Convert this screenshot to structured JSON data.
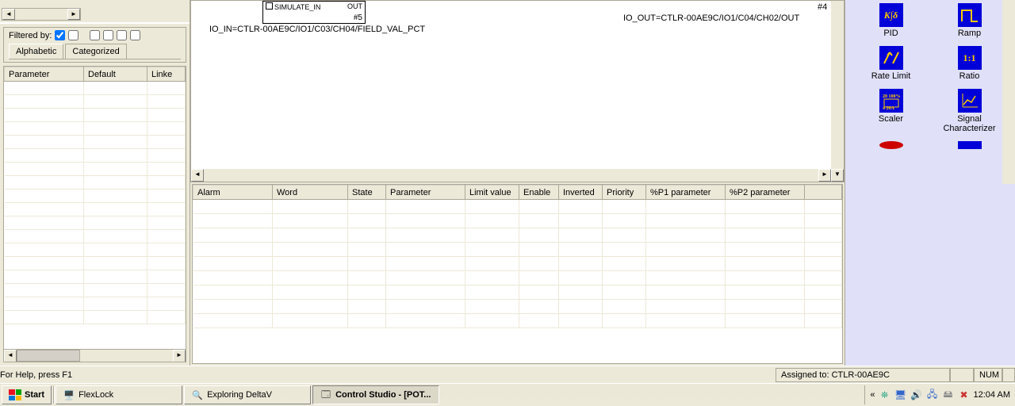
{
  "left": {
    "filtered_label": "Filtered by:",
    "tabs": {
      "alphabetic": "Alphabetic",
      "categorized": "Categorized"
    },
    "param_headers": [
      "Parameter",
      "Default",
      "Linke"
    ]
  },
  "canvas": {
    "fb": {
      "sim_in": "SIMULATE_IN",
      "out": "OUT",
      "id": "#5",
      "id2": "#4"
    },
    "io_in": "IO_IN=CTLR-00AE9C/IO1/C03/CH04/FIELD_VAL_PCT",
    "io_out": "IO_OUT=CTLR-00AE9C/IO1/C04/CH02/OUT"
  },
  "alarm_headers": [
    "Alarm",
    "Word",
    "State",
    "Parameter",
    "Limit value",
    "Enable",
    "Inverted",
    "Priority",
    "%P1 parameter",
    "%P2 parameter",
    ""
  ],
  "palette": {
    "pid": "PID",
    "ramp": "Ramp",
    "rate_limit": "Rate Limit",
    "ratio": "Ratio",
    "scaler": "Scaler",
    "sig_char": "Signal Characterizer"
  },
  "status": {
    "help": "For Help, press F1",
    "assigned": "Assigned to: CTLR-00AE9C",
    "num": "NUM"
  },
  "taskbar": {
    "start": "Start",
    "flexlock": "FlexLock",
    "exploring": "Exploring DeltaV",
    "control_studio": "Control Studio - [POT...",
    "clock": "12:04 AM",
    "chevrons": "«"
  }
}
